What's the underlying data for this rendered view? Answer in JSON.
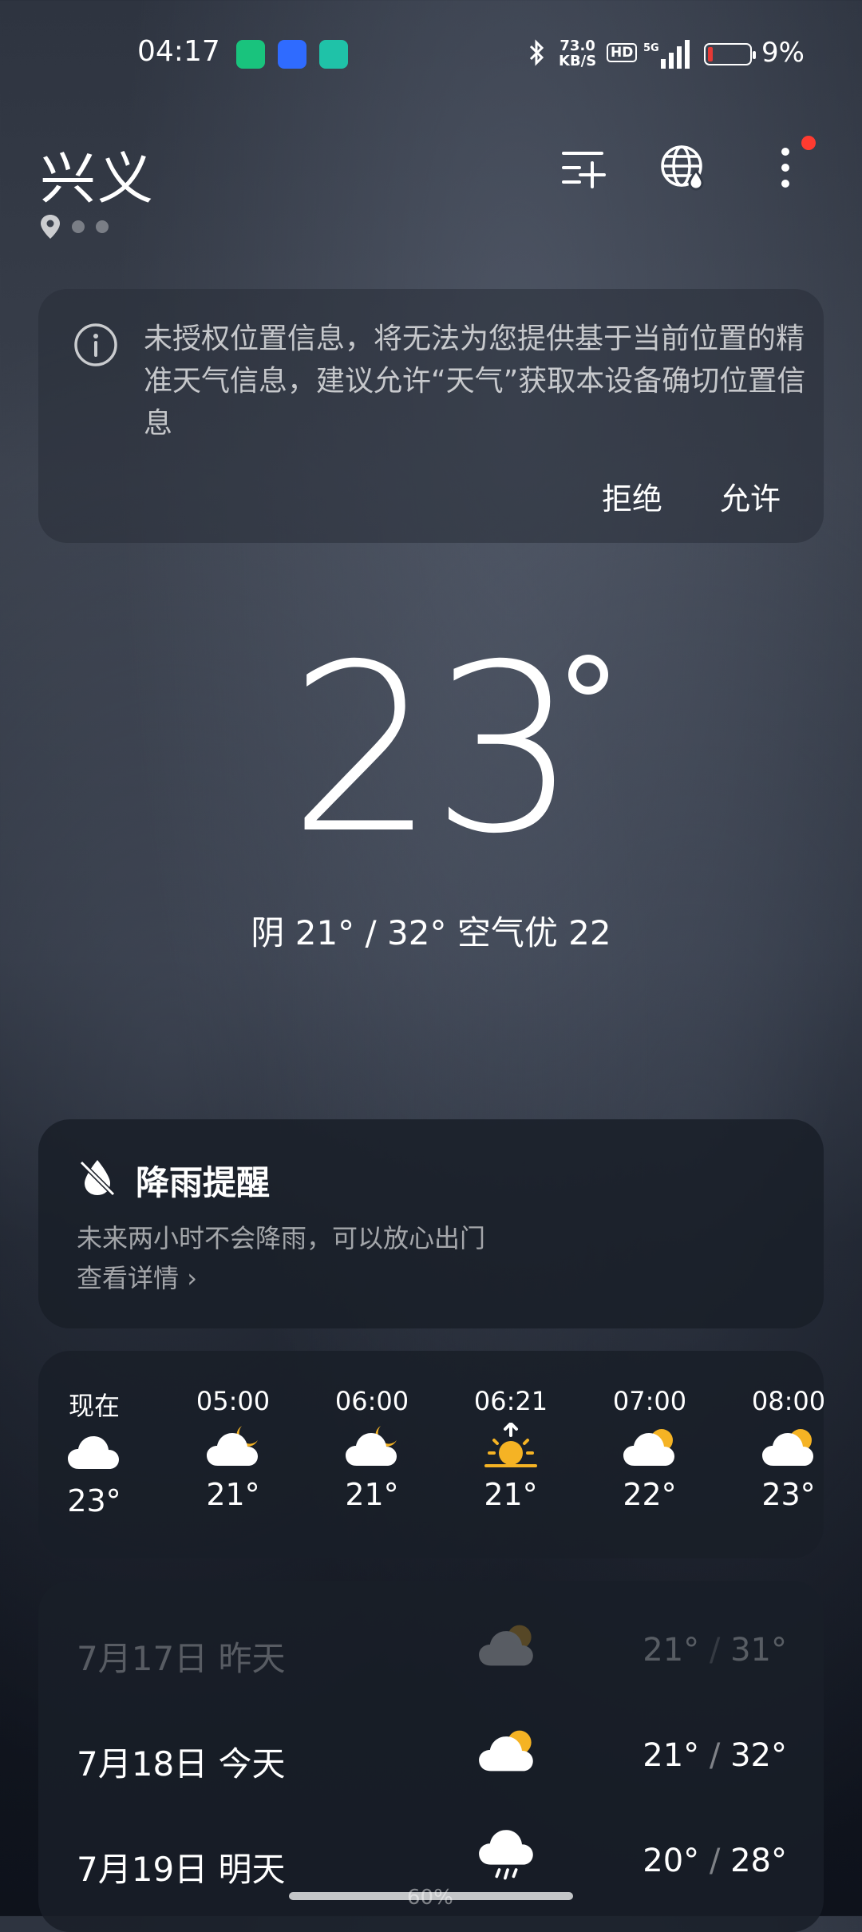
{
  "status_bar": {
    "time": "04:17",
    "net_speed_value": "73.0",
    "net_speed_unit": "KB/S",
    "hd": "HD",
    "network": "5G",
    "battery": "9%"
  },
  "header": {
    "city": "兴义",
    "icons": [
      "add-city-icon",
      "globe-icon",
      "more-icon"
    ]
  },
  "permission": {
    "message": "未授权位置信息，将无法为您提供基于当前位置的精准天气信息，建议允许“天气”获取本设备确切位置信息",
    "deny_label": "拒绝",
    "allow_label": "允许"
  },
  "current": {
    "temp": "23",
    "summary": "阴  21° / 32°  空气优 22"
  },
  "rain_alert": {
    "title": "降雨提醒",
    "desc": "未来两小时不会降雨，可以放心出门",
    "link": "查看详情"
  },
  "hourly": [
    {
      "time": "现在",
      "icon": "cloudy-icon",
      "temp": "23°"
    },
    {
      "time": "05:00",
      "icon": "cloudy-night-icon",
      "temp": "21°"
    },
    {
      "time": "06:00",
      "icon": "cloudy-night-icon",
      "temp": "21°"
    },
    {
      "time": "06:21",
      "icon": "sunrise-icon",
      "temp": "21°"
    },
    {
      "time": "07:00",
      "icon": "partly-cloudy-icon",
      "temp": "22°"
    },
    {
      "time": "08:00",
      "icon": "partly-cloudy-icon",
      "temp": "23°"
    }
  ],
  "daily": [
    {
      "date": "7月17日  昨天",
      "icon": "partly-cloudy-icon",
      "low": "21°",
      "high": "31°"
    },
    {
      "date": "7月18日  今天",
      "icon": "partly-cloudy-icon",
      "low": "21°",
      "high": "32°"
    },
    {
      "date": "7月19日  明天",
      "icon": "rain-icon",
      "low": "20°",
      "high": "28°",
      "pop": "60%"
    }
  ]
}
